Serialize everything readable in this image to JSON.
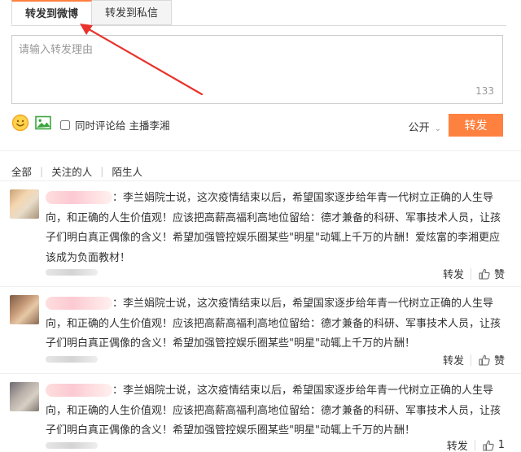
{
  "tabs": [
    {
      "label": "转发到微博",
      "active": true
    },
    {
      "label": "转发到私信",
      "active": false
    }
  ],
  "composer": {
    "placeholder": "请输入转发理由",
    "remaining": "133"
  },
  "toolbar": {
    "emoji_icon": "smiley-icon",
    "image_icon": "image-icon",
    "sync_label": "同时评论给 主播李湘",
    "sync_checked": false,
    "visibility": "公开",
    "submit_label": "转发"
  },
  "filters": [
    "全部",
    "关注的人",
    "陌生人"
  ],
  "comments": [
    {
      "text": "：李兰娟院士说，这次疫情结束以后，希望国家逐步给年青一代树立正确的人生导向，和正确的人生价值观！应该把高薪高福利高地位留给：德才兼备的科研、军事技术人员，让孩子们明白真正偶像的含义！希望加强管控娱乐圈某些\"明星\"动辄上千万的片酬！爱炫富的李湘更应该成为负面教材！",
      "repost": "转发",
      "like": "赞"
    },
    {
      "text": "：李兰娟院士说，这次疫情结束以后，希望国家逐步给年青一代树立正确的人生导向，和正确的人生价值观！应该把高薪高福利高地位留给：德才兼备的科研、军事技术人员，让孩子们明白真正偶像的含义！希望加强管控娱乐圈某些\"明星\"动辄上千万的片酬！",
      "repost": "转发",
      "like": "赞"
    },
    {
      "text": "：李兰娟院士说，这次疫情结束以后，希望国家逐步给年青一代树立正确的人生导向，和正确的人生价值观！应该把高薪高福利高地位留给：德才兼备的科研、军事技术人员，让孩子们明白真正偶像的含义！希望加强管控娱乐圈某些\"明星\"动辄上千万的片酬！",
      "repost": "转发",
      "like": "1"
    }
  ],
  "colors": {
    "accent": "#ff8140",
    "annotation_arrow": "#e8332c"
  }
}
